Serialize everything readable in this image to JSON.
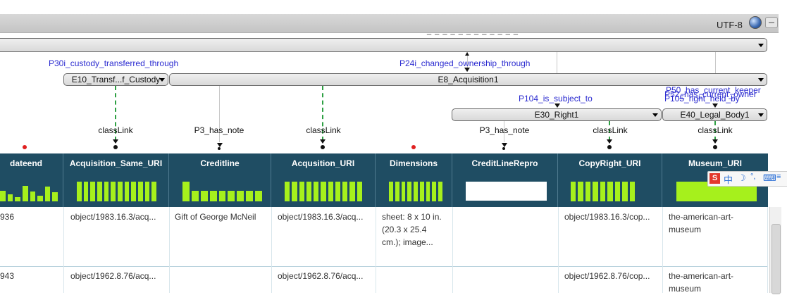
{
  "toolbar": {
    "encoding": "UTF-8"
  },
  "partial_top_text": "_ _ _ _ _ _ _ _ _ _ _ _",
  "nodes": {
    "e10": "E10_Transf...f_Custody",
    "e8": "E8_Acquisition1",
    "e30": "E30_Right1",
    "e40": "E40_Legal_Body1"
  },
  "properties": {
    "p30i": "P30i_custody_transferred_through",
    "p24i": "P24i_changed_ownership_through",
    "p104": "P104_is_subject_to",
    "p50": "P50_has_current_keeper",
    "p52": "P52_has_current_owner",
    "p105": "P105_right_held_by"
  },
  "link_labels": [
    "classLink",
    "P3_has_note",
    "classLink",
    "P3_has_note",
    "classLink",
    "classLink"
  ],
  "columns": [
    {
      "title": "dateend",
      "bars": [
        0.55,
        0.35,
        0.2,
        0.8,
        0.5,
        0.3,
        0.75,
        0.45
      ]
    },
    {
      "title": "Acquisition_Same_URI",
      "bars": [
        1,
        1,
        1,
        1,
        1,
        1,
        1,
        1,
        1,
        1,
        1,
        1
      ]
    },
    {
      "title": "Creditline",
      "bars": [
        1,
        0.55,
        0.55,
        0.55,
        0.55,
        0.55,
        0.55,
        0.55,
        0.55
      ]
    },
    {
      "title": "Acqusition_URI",
      "bars": [
        1,
        1,
        1,
        1,
        1,
        1,
        1,
        1,
        1,
        1,
        1
      ]
    },
    {
      "title": "Dimensions",
      "bars": [
        1,
        1,
        1,
        1,
        1,
        1,
        1,
        1,
        1
      ]
    },
    {
      "title": "CreditLineRepro",
      "bars": []
    },
    {
      "title": "CopyRight_URI",
      "bars": [
        1,
        1,
        1,
        1,
        1,
        1,
        1,
        1,
        1
      ]
    },
    {
      "title": "Museum_URI",
      "bars": [
        1
      ]
    }
  ],
  "rows": [
    [
      "936",
      "object/1983.16.3/acq...",
      "Gift of George McNeil",
      "object/1983.16.3/acq...",
      "sheet: 8 x 10 in. (20.3 x 25.4 cm.); image...",
      "",
      "object/1983.16.3/cop...",
      "the-american-art-museum"
    ],
    [
      "943",
      "object/1962.8.76/acq...",
      "",
      "object/1962.8.76/acq...",
      "",
      "",
      "object/1962.8.76/cop...",
      "the-american-art-museum"
    ]
  ],
  "ime": {
    "lang": "中"
  },
  "colors": {
    "header_bg": "#1f4d63",
    "bar_green": "#a6f01c",
    "property_blue": "#2a2ad0",
    "dash_green": "#2ea043"
  }
}
